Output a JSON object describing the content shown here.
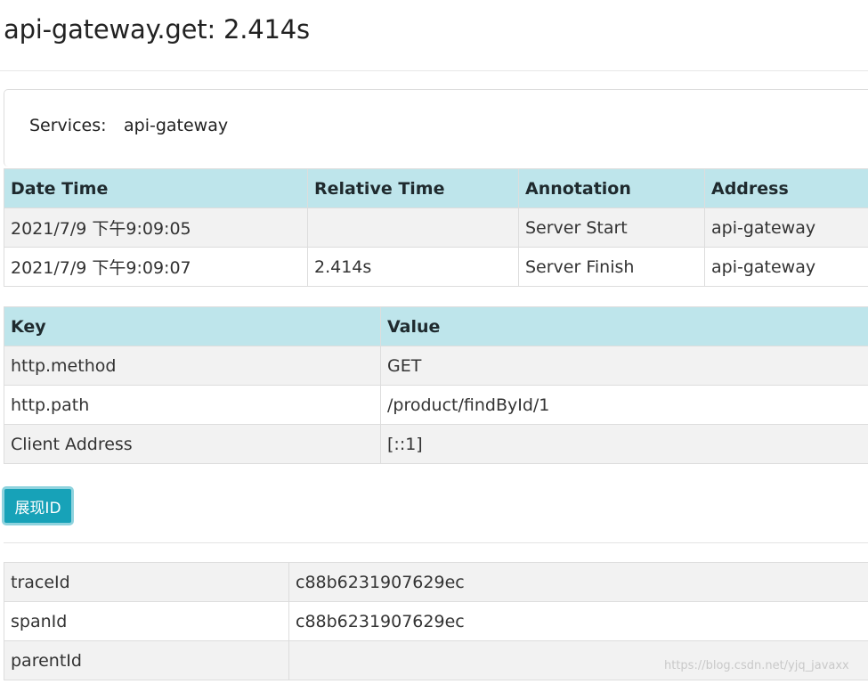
{
  "title": "api-gateway.get: 2.414s",
  "services": {
    "label": "Services:",
    "value": "api-gateway"
  },
  "annotations": {
    "headers": [
      "Date Time",
      "Relative Time",
      "Annotation",
      "Address"
    ],
    "rows": [
      [
        "2021/7/9 下午9:09:05",
        "",
        "Server Start",
        "api-gateway"
      ],
      [
        "2021/7/9 下午9:09:07",
        "2.414s",
        "Server Finish",
        "api-gateway"
      ]
    ]
  },
  "tags": {
    "headers": [
      "Key",
      "Value"
    ],
    "rows": [
      [
        "http.method",
        "GET"
      ],
      [
        "http.path",
        "/product/findById/1"
      ],
      [
        "Client Address",
        "[::1]"
      ]
    ]
  },
  "show_id_button": "展现ID",
  "ids": {
    "rows": [
      [
        "traceId",
        "c88b6231907629ec"
      ],
      [
        "spanId",
        "c88b6231907629ec"
      ],
      [
        "parentId",
        ""
      ]
    ]
  },
  "watermark": "https://blog.csdn.net/yjq_javaxx",
  "colors": {
    "table_header_bg": "#bee5eb",
    "button_bg": "#17a2b8",
    "striped_row_bg": "#f2f2f2"
  }
}
